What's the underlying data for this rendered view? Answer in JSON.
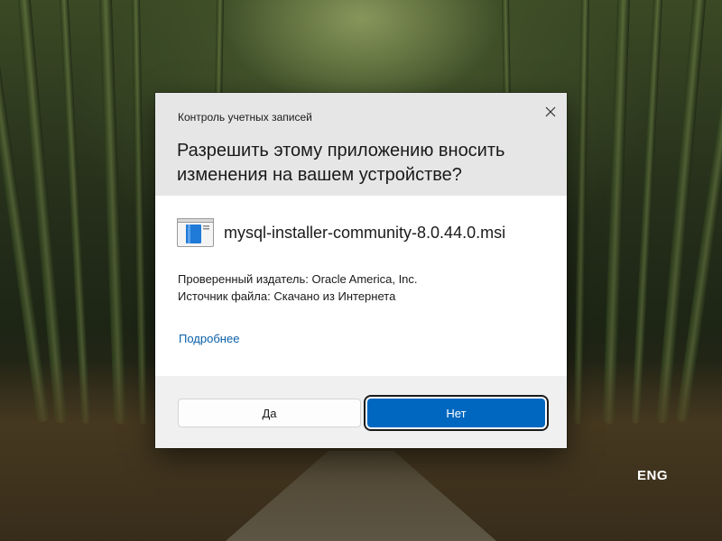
{
  "dialog": {
    "caption": "Контроль учетных записей",
    "question": "Разрешить этому приложению вносить изменения на вашем устройстве?",
    "app_name": "mysql-installer-community-8.0.44.0.msi",
    "app_icon": "msi-installer-icon",
    "publisher": "Проверенный издатель: Oracle America, Inc.",
    "file_source": "Источник файла: Скачано из Интернета",
    "details_link": "Подробнее",
    "yes_label": "Да",
    "no_label": "Нет",
    "close_icon": "close-icon"
  },
  "system": {
    "language": "ENG"
  },
  "colors": {
    "primary_button": "#0067c0",
    "link": "#0a5fa8",
    "header_background": "#e6e6e6",
    "footer_background": "#f0f0f0"
  }
}
